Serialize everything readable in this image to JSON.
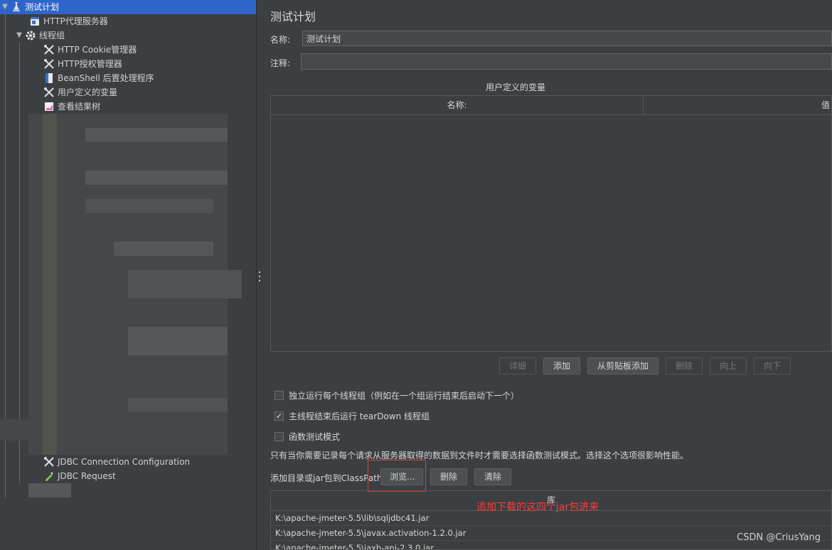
{
  "tree": {
    "items": [
      {
        "label": "测试计划",
        "icon": "test-plan-icon"
      },
      {
        "label": "HTTP代理服务器",
        "icon": "http-proxy-icon"
      },
      {
        "label": "线程组",
        "icon": "gear-icon"
      },
      {
        "label": "HTTP Cookie管理器",
        "icon": "wrench-icon"
      },
      {
        "label": "HTTP授权管理器",
        "icon": "wrench-icon"
      },
      {
        "label": "BeanShell 后置处理程序",
        "icon": "script-icon"
      },
      {
        "label": "用户定义的变量",
        "icon": "wrench-icon"
      },
      {
        "label": "查看结果树",
        "icon": "chart-icon"
      },
      {
        "label": "JDBC Connection Configuration",
        "icon": "wrench-icon"
      },
      {
        "label": "JDBC Request",
        "icon": "pipette-icon"
      }
    ]
  },
  "main": {
    "title": "测试计划",
    "name_label": "名称:",
    "name_value": "测试计划",
    "comment_label": "注释:",
    "comment_value": "",
    "vars_caption": "用户定义的变量",
    "vars_table": {
      "headers": [
        "名称:",
        "值"
      ]
    },
    "buttons": {
      "detail": "详细",
      "add": "添加",
      "add_clipboard": "从剪贴板添加",
      "delete": "删除",
      "up": "向上",
      "down": "向下"
    },
    "checkboxes": [
      {
        "label": "独立运行每个线程组（例如在一个组运行结束后启动下一个）",
        "checked": false
      },
      {
        "label": "主线程结束后运行 tearDown 线程组",
        "checked": true
      },
      {
        "label": "函数测试模式",
        "checked": false
      }
    ],
    "info_text": "只有当你需要记录每个请求从服务器取得的数据到文件时才需要选择函数测试模式。选择这个选项很影响性能。",
    "classpath_label": "添加目录或jar包到ClassPath",
    "classpath_buttons": {
      "browse": "浏览...",
      "delete": "删除",
      "clear": "清除"
    },
    "lib_header": "库",
    "libs": [
      "K:\\apache-jmeter-5.5\\lib\\sqljdbc41.jar",
      "K:\\apache-jmeter-5.5\\javax.activation-1.2.0.jar",
      "K:\\apache-jmeter-5.5\\jaxb-api-2.3.0.jar"
    ],
    "annotation": "追加下载的这四个jar包进来",
    "annotation_color": "#ff3b3b"
  },
  "watermark": "CSDN @CriusYang",
  "colors": {
    "selection": "#2f65ca",
    "background": "#3c3f41"
  }
}
